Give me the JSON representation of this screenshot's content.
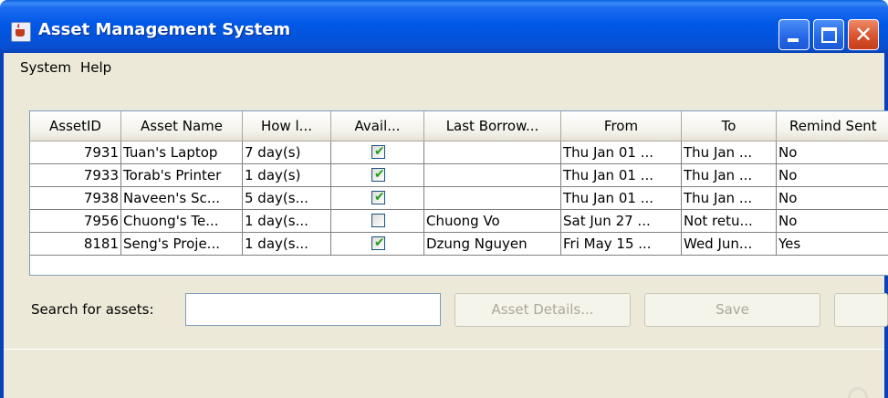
{
  "window": {
    "title": "Asset Management System"
  },
  "menu": {
    "items": [
      "System",
      "Help"
    ]
  },
  "table": {
    "columns": [
      "AssetID",
      "Asset Name",
      "How l...",
      "Avail...",
      "Last Borrow...",
      "From",
      "To",
      "Remind Sent"
    ],
    "rows": [
      {
        "asset_id": "7931",
        "asset_name": "Tuan's Laptop",
        "how_long": "7 day(s)",
        "available": true,
        "last_borrower": "",
        "from": "Thu Jan 01 ...",
        "to": "Thu Jan ...",
        "remind_sent": "No"
      },
      {
        "asset_id": "7933",
        "asset_name": "Torab's Printer",
        "how_long": "1 day(s)",
        "available": true,
        "last_borrower": "",
        "from": "Thu Jan 01 ...",
        "to": "Thu Jan ...",
        "remind_sent": "No"
      },
      {
        "asset_id": "7938",
        "asset_name": "Naveen's Sc...",
        "how_long": "5 day(s...",
        "available": true,
        "last_borrower": "",
        "from": "Thu Jan 01 ...",
        "to": "Thu Jan ...",
        "remind_sent": "No"
      },
      {
        "asset_id": "7956",
        "asset_name": "Chuong's Te...",
        "how_long": "1 day(s...",
        "available": false,
        "last_borrower": "Chuong Vo",
        "from": "Sat Jun 27 ...",
        "to": "Not retu...",
        "remind_sent": "No"
      },
      {
        "asset_id": "8181",
        "asset_name": "Seng's Proje...",
        "how_long": "1 day(s...",
        "available": true,
        "last_borrower": "Dzung Nguyen",
        "from": "Fri May 15 ...",
        "to": "Wed Jun...",
        "remind_sent": "Yes"
      }
    ]
  },
  "search": {
    "label": "Search for assets:",
    "value": ""
  },
  "buttons": {
    "asset_details": "Asset Details...",
    "save": "Save"
  },
  "icons": {
    "app": "java-cup-icon",
    "minimize": "minimize-icon",
    "maximize": "maximize-icon",
    "close": "close-icon",
    "check": "check-icon"
  },
  "colors": {
    "titlebar": "#0058e6",
    "frame": "#ece9d8",
    "close_button": "#d9532e",
    "check": "#21a121"
  }
}
